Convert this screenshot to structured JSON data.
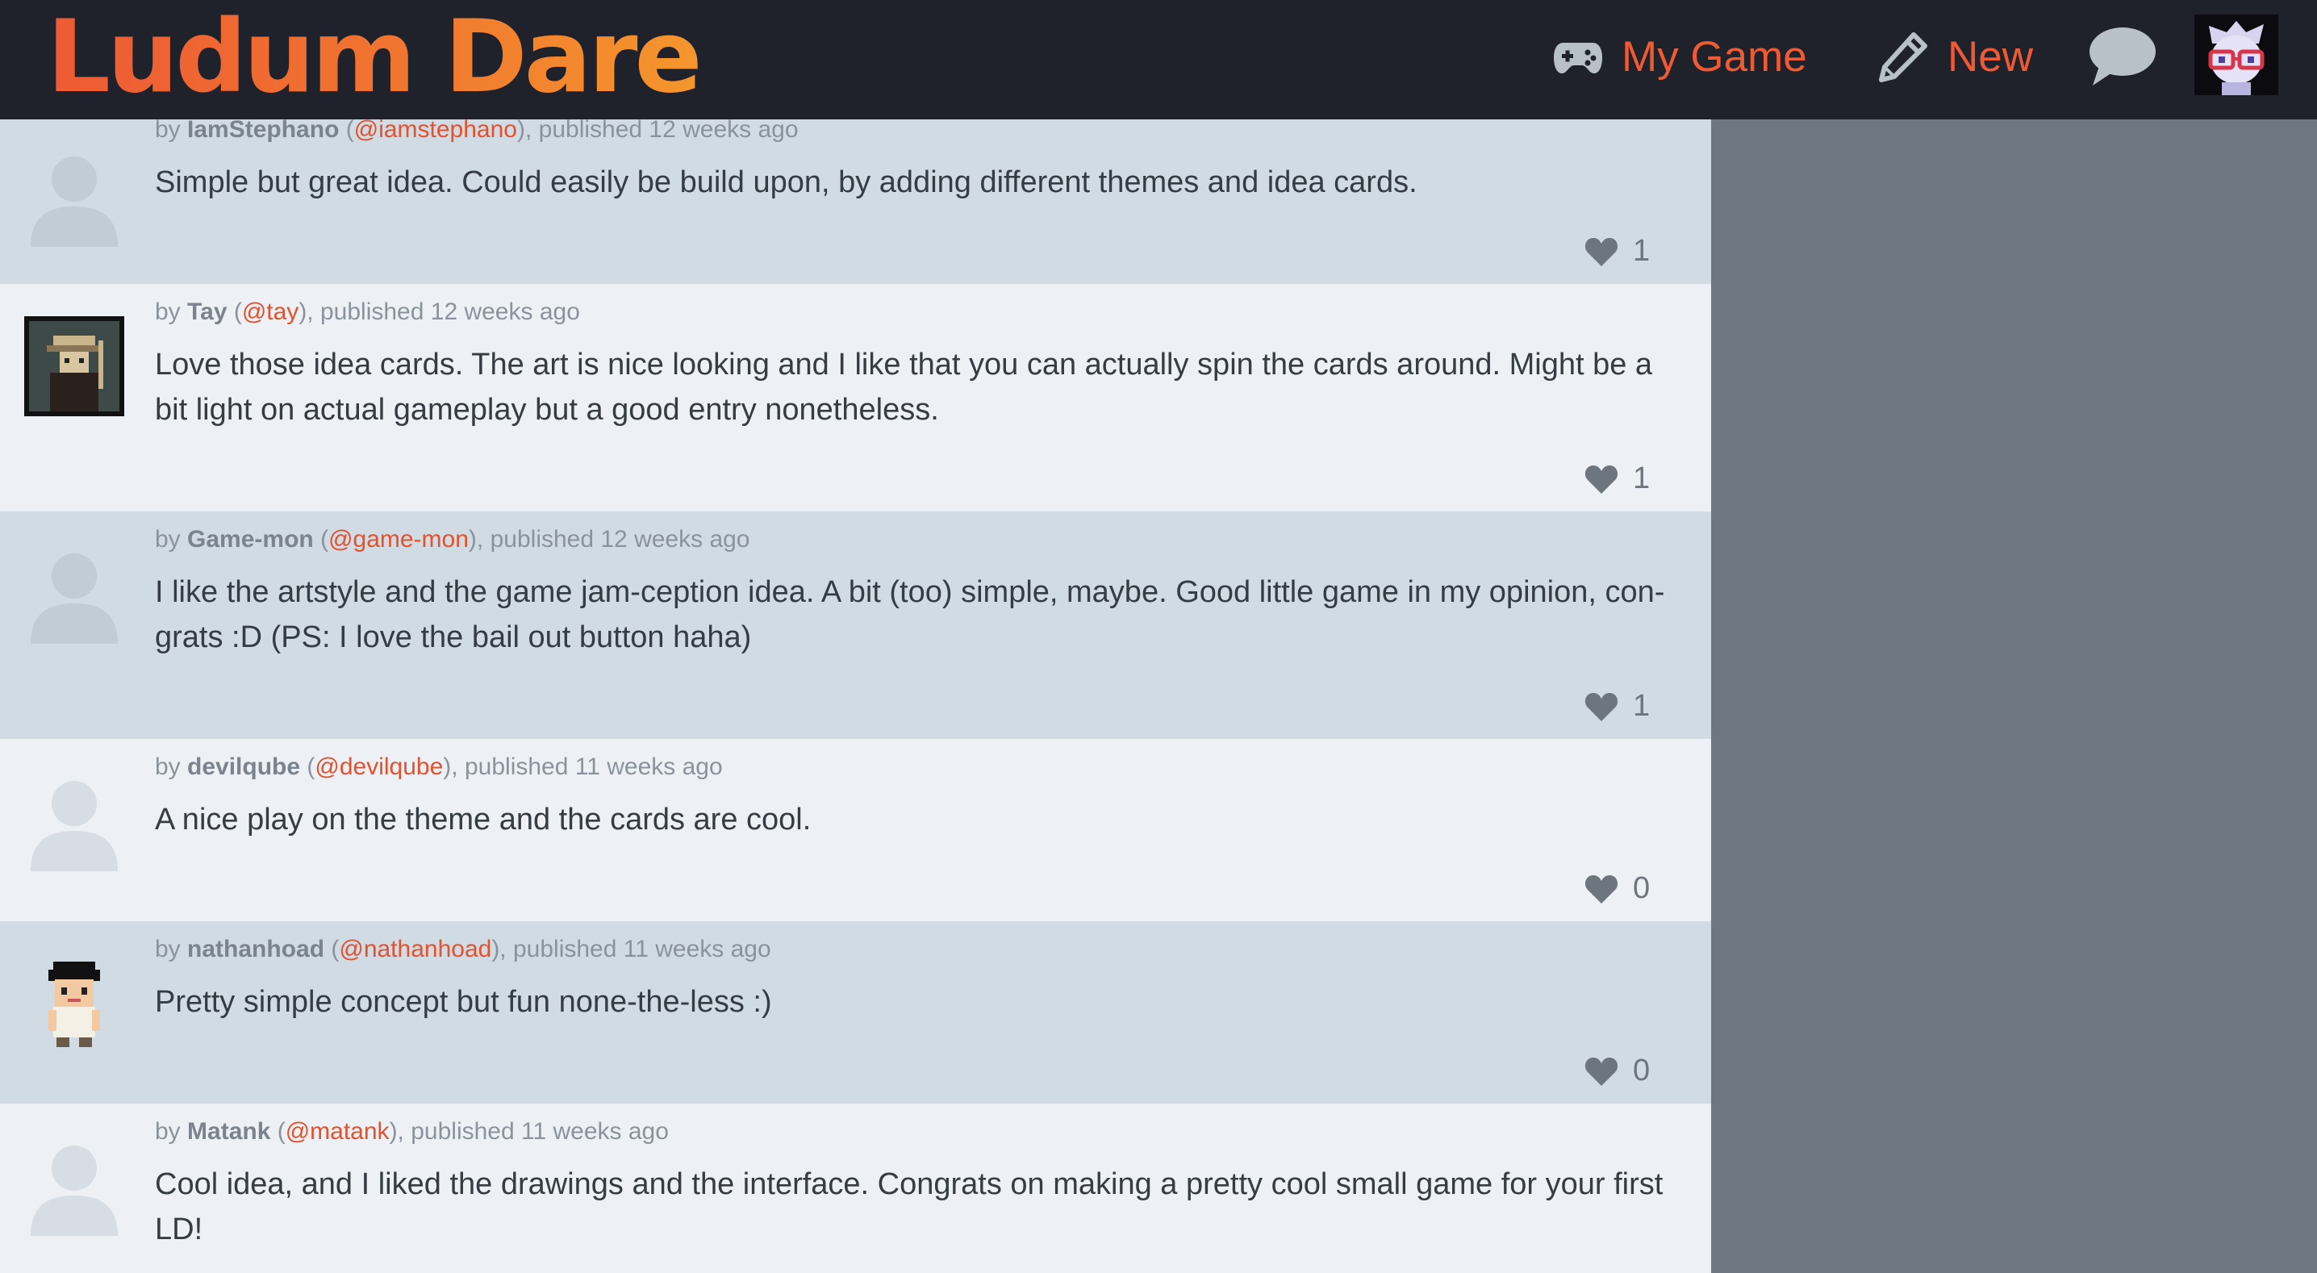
{
  "header": {
    "logo": "Ludum Dare",
    "my_game_label": "My Game",
    "new_label": "New",
    "gamepad_icon": "gamepad-icon",
    "pencil_icon": "pencil-icon",
    "chat_icon": "speech-bubble-icon"
  },
  "colors": {
    "header_bg": "#1f222b",
    "accent": "#ee5a34",
    "comment_dark": "#d1dbe3",
    "comment_light": "#edf1f5",
    "sidebar": "#6e7780"
  },
  "comments": [
    {
      "by": "by",
      "author": "IamStephano",
      "handle": "@iamstephano",
      "published": "published 12 weeks ago",
      "text": "Simple but great idea. Could easily be build upon, by adding different themes and idea cards.",
      "likes": "1",
      "avatar": "default-avatar"
    },
    {
      "by": "by",
      "author": "Tay",
      "handle": "@tay",
      "published": "published 12 weeks ago",
      "text": "Love those idea cards. The art is nice looking and I like that you can actually spin the cards around. Might be a bit light on actual gameplay but a good entry nonetheless.",
      "likes": "1",
      "avatar": "pixel-art-avatar"
    },
    {
      "by": "by",
      "author": "Game-mon",
      "handle": "@game-mon",
      "published": "published 12 weeks ago",
      "text": "I like the artstyle and the game jam-ception idea. A bit (too) simple, maybe. Good little game in my opinion, con-grats :D (PS: I love the bail out button haha)",
      "likes": "1",
      "avatar": "default-avatar"
    },
    {
      "by": "by",
      "author": "devilqube",
      "handle": "@devilqube",
      "published": "published 11 weeks ago",
      "text": "A nice play on the theme and the cards are cool.",
      "likes": "0",
      "avatar": "default-avatar"
    },
    {
      "by": "by",
      "author": "nathanhoad",
      "handle": "@nathanhoad",
      "published": "published 11 weeks ago",
      "text": "Pretty simple concept but fun none-the-less :)",
      "likes": "0",
      "avatar": "pixel-character-avatar"
    },
    {
      "by": "by",
      "author": "Matank",
      "handle": "@matank",
      "published": "published 11 weeks ago",
      "text": "Cool idea, and I liked the drawings and the interface. Congrats on making a pretty cool small game for your first LD!",
      "likes": "",
      "avatar": "default-avatar"
    }
  ]
}
